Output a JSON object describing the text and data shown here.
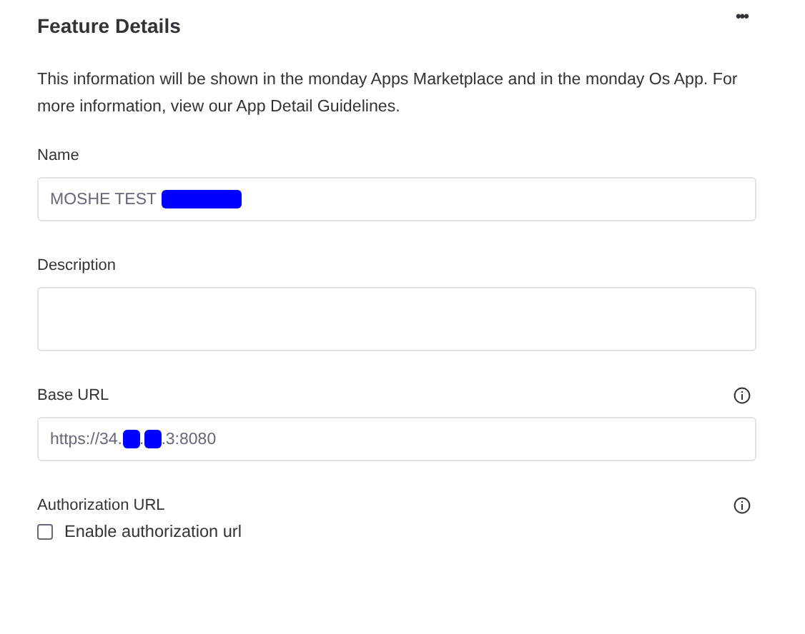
{
  "header": {
    "title": "Feature Details",
    "menu": "•••"
  },
  "intro": "This information will be shown in the monday Apps Marketplace and in the monday Os App. For more information, view our App Detail Guidelines.",
  "fields": [
    {
      "kind": "input",
      "label": "Name",
      "info": false,
      "segments": [
        {
          "kind": "text",
          "text": "MOSHE TEST "
        },
        {
          "kind": "redacted"
        }
      ]
    },
    {
      "kind": "textarea",
      "label": "Description",
      "info": false
    },
    {
      "kind": "input",
      "label": "Base URL",
      "info": true,
      "segments": [
        {
          "kind": "text",
          "text": "https://34."
        },
        {
          "kind": "redacted"
        },
        {
          "kind": "text",
          "text": "."
        },
        {
          "kind": "redacted"
        },
        {
          "kind": "text",
          "text": ".3:8080"
        }
      ]
    },
    {
      "kind": "checkbox",
      "label": "Authorization URL",
      "info": true,
      "checkbox": {
        "label": "Enable authorization url",
        "checked": false
      }
    }
  ]
}
